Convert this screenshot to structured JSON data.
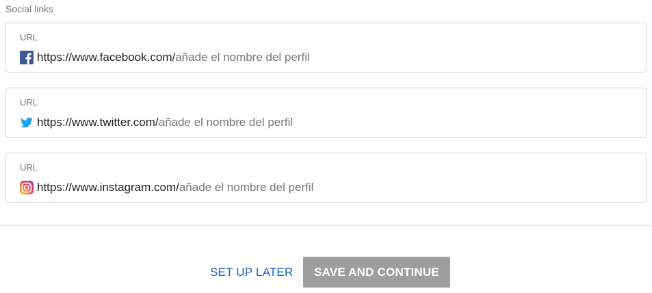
{
  "section": {
    "title": "Social links"
  },
  "fields": [
    {
      "label": "URL",
      "prefix": "https://www.facebook.com/",
      "placeholder": "añade el nombre del perfil",
      "value": "",
      "icon": "facebook-icon"
    },
    {
      "label": "URL",
      "prefix": "https://www.twitter.com/",
      "placeholder": "añade el nombre del perfil",
      "value": "",
      "icon": "twitter-icon"
    },
    {
      "label": "URL",
      "prefix": "https://www.instagram.com/",
      "placeholder": "añade el nombre del perfil",
      "value": "",
      "icon": "instagram-icon"
    }
  ],
  "actions": {
    "later_label": "SET UP LATER",
    "save_label": "SAVE AND CONTINUE"
  },
  "colors": {
    "link": "#1565c0",
    "button_disabled": "#9e9e9e",
    "facebook": "#3b5998",
    "twitter": "#1da1f2",
    "border": "#d6d6d6"
  }
}
